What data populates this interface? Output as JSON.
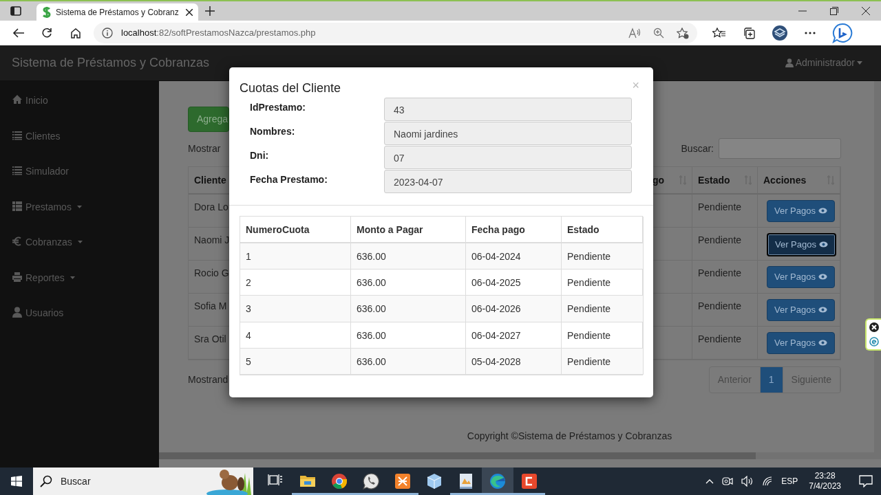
{
  "browser": {
    "tab_title": "Sistema de Préstamos y Cobranz",
    "url_host": "localhost",
    "url_rest": ":82/softPrestamosNazca/prestamos.php"
  },
  "navbar": {
    "brand": "Sistema de Préstamos y Cobranzas",
    "user": "Administrador"
  },
  "sidebar": {
    "items": [
      {
        "label": "Inicio",
        "dropdown": false
      },
      {
        "label": "Clientes",
        "dropdown": false
      },
      {
        "label": "Simulador",
        "dropdown": false
      },
      {
        "label": "Prestamos",
        "dropdown": true
      },
      {
        "label": "Cobranzas",
        "dropdown": true
      },
      {
        "label": "Reportes",
        "dropdown": true
      },
      {
        "label": "Usuarios",
        "dropdown": false
      }
    ]
  },
  "page": {
    "add_button": "Agrega",
    "length_label": "Mostrar",
    "search_label": "Buscar:",
    "columns": [
      "Cliente",
      "go",
      "Estado",
      "Acciones"
    ],
    "rows": [
      {
        "cliente": "Dora Lo",
        "estado": "Pendiente",
        "action": "Ver Pagos",
        "focused": false
      },
      {
        "cliente": "Naomi J",
        "estado": "Pendiente",
        "action": "Ver Pagos",
        "focused": true
      },
      {
        "cliente": "Rocio G",
        "estado": "Pendiente",
        "action": "Ver Pagos",
        "focused": false
      },
      {
        "cliente": "Sofia M",
        "estado": "Pendiente",
        "action": "Ver Pagos",
        "focused": false
      },
      {
        "cliente": "Sra Otil",
        "estado": "Pendiente",
        "action": "Ver Pagos",
        "focused": false
      }
    ],
    "info": "Mostrand",
    "pagination": [
      {
        "label": "Anterior",
        "selected": false
      },
      {
        "label": "1",
        "selected": true
      },
      {
        "label": "Siguiente",
        "selected": false
      }
    ],
    "footer": "Copyright ©Sistema de Préstamos y Cobranzas"
  },
  "modal": {
    "title": "Cuotas del Cliente",
    "close": "×",
    "fields": [
      {
        "label": "IdPrestamo:",
        "value": "43"
      },
      {
        "label": "Nombres:",
        "value": "Naomi jardines"
      },
      {
        "label": "Dni:",
        "value": "07"
      },
      {
        "label": "Fecha Prestamo:",
        "value": "2023-04-07"
      }
    ],
    "table": {
      "columns": [
        "NumeroCuota",
        "Monto a Pagar",
        "Fecha pago",
        "Estado"
      ],
      "rows": [
        [
          "1",
          "636.00",
          "06-04-2024",
          "Pendiente"
        ],
        [
          "2",
          "636.00",
          "06-04-2025",
          "Pendiente"
        ],
        [
          "3",
          "636.00",
          "06-04-2026",
          "Pendiente"
        ],
        [
          "4",
          "636.00",
          "06-04-2027",
          "Pendiente"
        ],
        [
          "5",
          "636.00",
          "05-04-2028",
          "Pendiente"
        ]
      ]
    }
  },
  "taskbar": {
    "search": {
      "placeholder": "Buscar"
    },
    "apps": [
      {
        "running": false,
        "selected": false
      },
      {
        "running": true,
        "selected": false
      },
      {
        "running": true,
        "selected": false
      },
      {
        "running": true,
        "selected": false
      },
      {
        "running": true,
        "selected": false
      },
      {
        "running": false,
        "selected": false
      },
      {
        "running": true,
        "selected": false
      },
      {
        "running": true,
        "selected": true
      },
      {
        "running": true,
        "selected": false
      }
    ],
    "language": "ESP",
    "time": "23:28",
    "date": "7/4/2023"
  }
}
